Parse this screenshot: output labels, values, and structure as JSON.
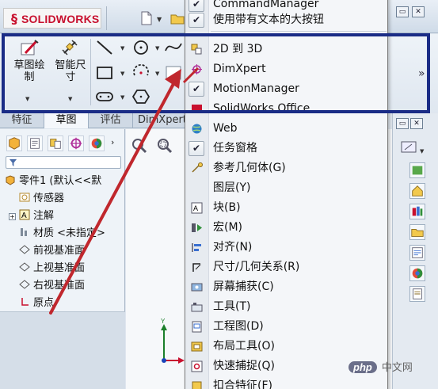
{
  "app": {
    "logo_text": "SOLIDWORKS"
  },
  "ribbon": {
    "sketch_label": "草图绘\n制",
    "smart_dim_label": "智能尺\n寸",
    "sketch_label_1": "草图绘",
    "sketch_label_2": "制",
    "smart_dim_label_1": "智能尺",
    "smart_dim_label_2": "寸"
  },
  "tabs": [
    {
      "label": "特征"
    },
    {
      "label": "草图",
      "active": true
    },
    {
      "label": "评估"
    },
    {
      "label": "DimXpert"
    }
  ],
  "tree": {
    "part": "零件1 (默认<<默",
    "items": [
      "传感器",
      "注解",
      "材质 <未指定>",
      "前视基准面",
      "上视基准面",
      "右视基准面",
      "原点"
    ]
  },
  "menu": {
    "items": [
      {
        "label": "CommandManager",
        "checked": true
      },
      {
        "label": "使用带有文本的大按钮",
        "checked": true
      },
      {
        "label": "2D 到 3D",
        "icon": "2d-to-3d-icon"
      },
      {
        "label": "DimXpert",
        "icon": "dimxpert-icon"
      },
      {
        "label": "MotionManager",
        "checked": true
      },
      {
        "label": "SolidWorks Office",
        "icon": "solidworks-office-icon"
      },
      {
        "label": "Web",
        "icon": "web-globe-icon"
      },
      {
        "label": "任务窗格",
        "checked": true
      },
      {
        "label": "参考几何体(G)",
        "icon": "reference-geometry-icon"
      },
      {
        "label": "图层(Y)",
        "icon": ""
      },
      {
        "label": "块(B)",
        "icon": "block-icon"
      },
      {
        "label": "宏(M)",
        "icon": "macro-icon"
      },
      {
        "label": "对齐(N)",
        "icon": "align-icon"
      },
      {
        "label": "尺寸/几何关系(R)",
        "icon": "dimensions-relations-icon"
      },
      {
        "label": "屏幕捕获(C)",
        "icon": "screen-capture-icon"
      },
      {
        "label": "工具(T)",
        "icon": "tools-icon"
      },
      {
        "label": "工程图(D)",
        "icon": "drawing-icon"
      },
      {
        "label": "布局工具(O)",
        "icon": "layout-tools-icon"
      },
      {
        "label": "快速捕捉(Q)",
        "icon": "quick-snap-icon"
      },
      {
        "label": "扣合特征(F)",
        "icon": "fastening-features-icon"
      }
    ]
  },
  "watermark": {
    "badge": "php",
    "text": "中文网"
  },
  "colors": {
    "highlight_border": "#1a2c86",
    "arrow": "#c0272d",
    "brand_red": "#c8102e"
  }
}
